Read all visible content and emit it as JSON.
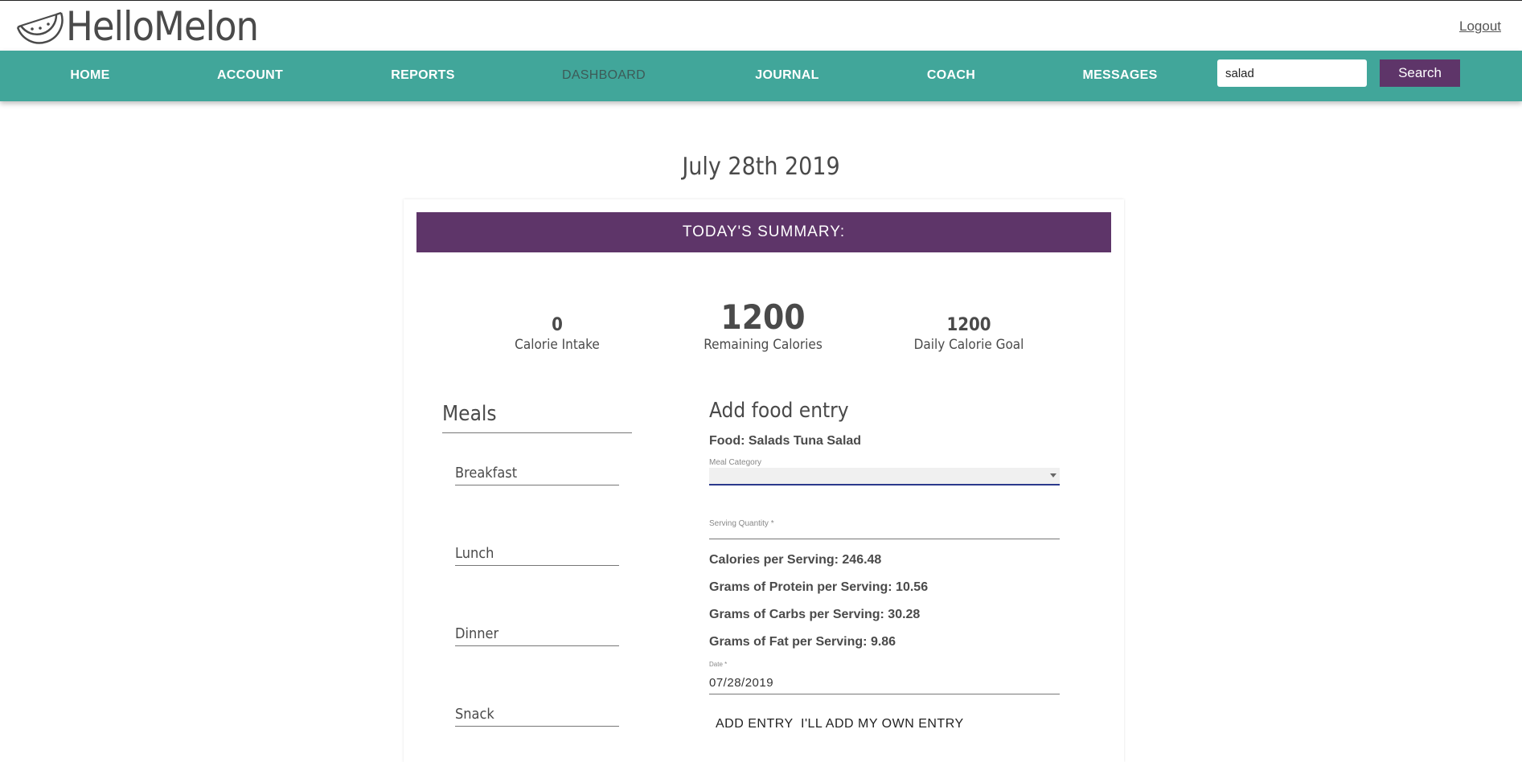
{
  "header": {
    "brand": "HelloMelon",
    "logout_label": "Logout"
  },
  "nav": {
    "items": [
      {
        "label": "HOME"
      },
      {
        "label": "ACCOUNT"
      },
      {
        "label": "REPORTS"
      },
      {
        "label": "DASHBOARD"
      },
      {
        "label": "JOURNAL"
      },
      {
        "label": "COACH"
      },
      {
        "label": "MESSAGES"
      }
    ],
    "active": "DASHBOARD",
    "search": {
      "value": "salad",
      "button_label": "Search"
    }
  },
  "page": {
    "date": "July 28th 2019"
  },
  "summary": {
    "title": "TODAY'S SUMMARY:",
    "calorie_intake": {
      "value": "0",
      "label": "Calorie Intake"
    },
    "remaining": {
      "value": "1200",
      "label": "Remaining Calories"
    },
    "goal": {
      "value": "1200",
      "label": "Daily Calorie Goal"
    }
  },
  "meals": {
    "title": "Meals",
    "items": [
      "Breakfast",
      "Lunch",
      "Dinner",
      "Snack"
    ]
  },
  "entry": {
    "title": "Add food entry",
    "food": "Food: Salads Tuna Salad",
    "meal_category_label": "Meal Category",
    "serving_quantity_label": "Serving Quantity *",
    "calories": "Calories per Serving: 246.48",
    "protein": "Grams of Protein per Serving: 10.56",
    "carbs": "Grams of Carbs per Serving: 30.28",
    "fat": "Grams of Fat per Serving: 9.86",
    "date_label": "Date *",
    "date_value": "07/28/2019",
    "add_button": "ADD ENTRY",
    "own_button": "I'LL ADD MY OWN ENTRY"
  },
  "colors": {
    "nav_bg": "#41a69a",
    "accent_purple": "#5e3569"
  },
  "icons": {
    "logo": "watermelon-slice-icon"
  }
}
